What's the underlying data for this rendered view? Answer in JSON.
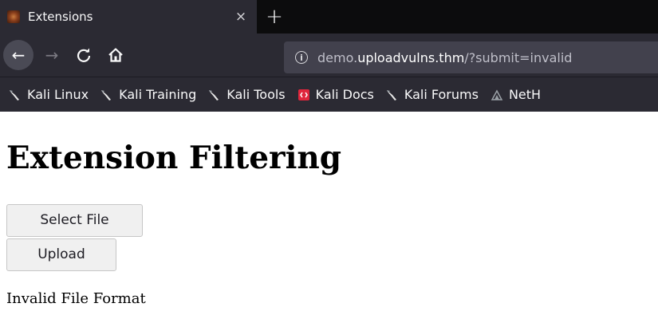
{
  "browser": {
    "tab": {
      "title": "Extensions",
      "close_glyph": "×"
    },
    "new_tab_glyph": "+",
    "nav": {
      "back_glyph": "←",
      "forward_glyph": "→",
      "reload_glyph": "C",
      "home_glyph": "⌂"
    },
    "url": {
      "info_glyph": "i",
      "prefix": "demo.",
      "domain": "uploadvulns.thm",
      "path": "/?submit=invalid"
    },
    "bookmarks": [
      {
        "label": "Kali Linux",
        "icon": "kali-dragon-icon"
      },
      {
        "label": "Kali Training",
        "icon": "kali-dragon-icon"
      },
      {
        "label": "Kali Tools",
        "icon": "kali-dragon-icon"
      },
      {
        "label": "Kali Docs",
        "icon": "kali-docs-icon"
      },
      {
        "label": "Kali Forums",
        "icon": "kali-dragon-icon"
      },
      {
        "label": "NetH",
        "icon": "nethunter-icon"
      }
    ]
  },
  "page": {
    "title": "Extension Filtering",
    "select_file_label": "Select File",
    "upload_label": "Upload",
    "status": "Invalid File Format"
  },
  "colors": {
    "chrome_dark": "#2b2a33",
    "tab_strip": "#0c0c0d",
    "url_bar": "#42414d",
    "docs_icon": "#e0263c"
  }
}
